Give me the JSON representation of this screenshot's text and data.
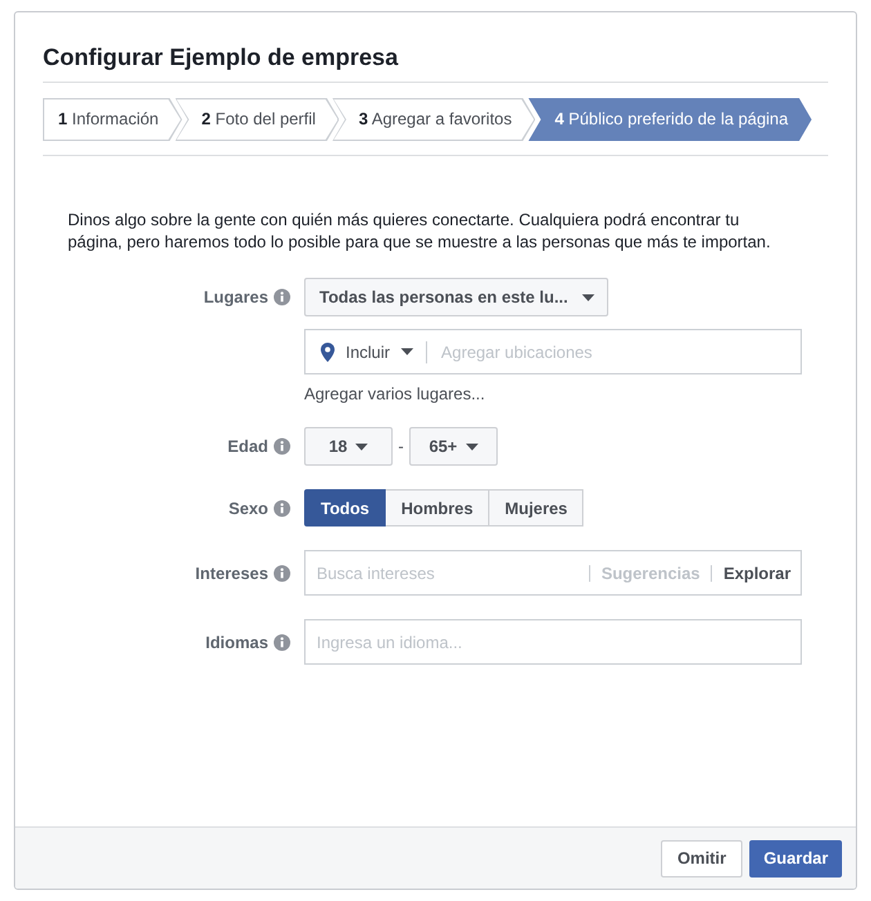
{
  "dialog": {
    "title": "Configurar Ejemplo de empresa"
  },
  "steps": [
    {
      "number": "1",
      "label": "Información",
      "selected": false
    },
    {
      "number": "2",
      "label": "Foto del perfil",
      "selected": false
    },
    {
      "number": "3",
      "label": "Agregar a favoritos",
      "selected": false
    },
    {
      "number": "4",
      "label": "Público preferido de la página",
      "selected": true
    }
  ],
  "description": "Dinos algo sobre la gente con quién más quieres conectarte. Cualquiera podrá encontrar tu página, pero haremos todo lo posible para que se muestre a las personas que más te importan.",
  "locations": {
    "label": "Lugares",
    "audience": "Todas las personas en este lu...",
    "include": "Incluir",
    "placeholder": "Agregar ubicaciones",
    "add_multiple": "Agregar varios lugares..."
  },
  "age": {
    "label": "Edad",
    "min": "18",
    "separator": "-",
    "max": "65+"
  },
  "gender": {
    "label": "Sexo",
    "options": [
      {
        "label": "Todos",
        "selected": true
      },
      {
        "label": "Hombres",
        "selected": false
      },
      {
        "label": "Mujeres",
        "selected": false
      }
    ]
  },
  "interests": {
    "label": "Intereses",
    "placeholder": "Busca intereses",
    "actions": [
      {
        "label": "Sugerencias",
        "disabled": true
      },
      {
        "label": "Explorar",
        "disabled": false
      }
    ]
  },
  "languages": {
    "label": "Idiomas",
    "placeholder": "Ingresa un idioma..."
  },
  "buttons": [
    {
      "label": "Omitir",
      "kind": "secondary"
    },
    {
      "label": "Guardar",
      "kind": "primary"
    }
  ]
}
